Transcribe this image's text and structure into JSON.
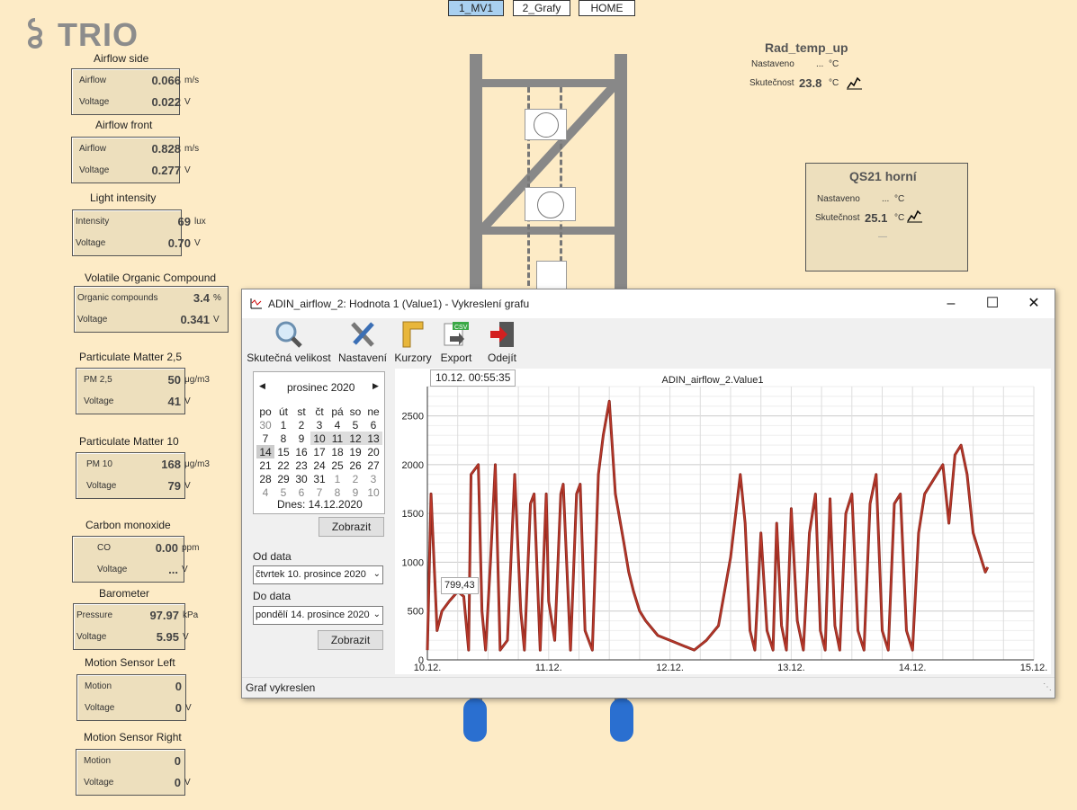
{
  "nav": {
    "tabs": [
      "1_MV1",
      "2_Grafy",
      "HOME"
    ]
  },
  "logo": {
    "text": "TRIO"
  },
  "sensors": {
    "airflow_side": {
      "title": "Airflow side",
      "r1_label": "Airflow",
      "r1_value": "0.066",
      "r1_unit": "m/s",
      "r2_label": "Voltage",
      "r2_value": "0.022",
      "r2_unit": "V"
    },
    "airflow_front": {
      "title": "Airflow front",
      "r1_label": "Airflow",
      "r1_value": "0.828",
      "r1_unit": "m/s",
      "r2_label": "Voltage",
      "r2_value": "0.277",
      "r2_unit": "V"
    },
    "light": {
      "title": "Light intensity",
      "r1_label": "Intensity",
      "r1_value": "69",
      "r1_unit": "lux",
      "r2_label": "Voltage",
      "r2_value": "0.70",
      "r2_unit": "V"
    },
    "voc": {
      "title": "Volatile Organic Compound",
      "r1_label": "Organic compounds",
      "r1_value": "3.4",
      "r1_unit": "%",
      "r2_label": "Voltage",
      "r2_value": "0.341",
      "r2_unit": "V"
    },
    "pm25": {
      "title": "Particulate Matter 2,5",
      "r1_label": "PM 2,5",
      "r1_value": "50",
      "r1_unit": "μg/m3",
      "r2_label": "Voltage",
      "r2_value": "41",
      "r2_unit": "V"
    },
    "pm10": {
      "title": "Particulate Matter 10",
      "r1_label": "PM 10",
      "r1_value": "168",
      "r1_unit": "μg/m3",
      "r2_label": "Voltage",
      "r2_value": "79",
      "r2_unit": "V"
    },
    "co": {
      "title": "Carbon monoxide",
      "r1_label": "CO",
      "r1_value": "0.00",
      "r1_unit": "ppm",
      "r2_label": "Voltage",
      "r2_value": "...",
      "r2_unit": "V"
    },
    "baro": {
      "title": "Barometer",
      "r1_label": "Pressure",
      "r1_value": "97.97",
      "r1_unit": "kPa",
      "r2_label": "Voltage",
      "r2_value": "5.95",
      "r2_unit": "V"
    },
    "motion_left": {
      "title": "Motion Sensor Left",
      "r1_label": "Motion",
      "r1_value": "0",
      "r1_unit": "",
      "r2_label": "Voltage",
      "r2_value": "0",
      "r2_unit": "V"
    },
    "motion_right": {
      "title": "Motion Sensor Right",
      "r1_label": "Motion",
      "r1_value": "0",
      "r1_unit": "",
      "r2_label": "Voltage",
      "r2_value": "0",
      "r2_unit": "V"
    }
  },
  "rad_temp": {
    "title": "Rad_temp_up",
    "set_label": "Nastaveno",
    "set_value": "...",
    "unit": "°C",
    "act_label": "Skutečnost",
    "act_value": "23.8"
  },
  "qs21": {
    "title": "QS21 horní",
    "set_label": "Nastaveno",
    "set_value": "...",
    "unit": "°C",
    "act_label": "Skutečnost",
    "act_value": "25.1",
    "extra": "—"
  },
  "window": {
    "title": "ADIN_airflow_2: Hodnota 1 (Value1) - Vykreslení grafu",
    "toolbar": [
      "Skutečná velikost",
      "Nastavení",
      "Kurzory",
      "Export",
      "Odejít"
    ],
    "export_badge": "CSV",
    "calendar": {
      "month": "prosinec 2020",
      "days": [
        "po",
        "út",
        "st",
        "čt",
        "pá",
        "so",
        "ne"
      ],
      "weeks": [
        [
          "30",
          "1",
          "2",
          "3",
          "4",
          "5",
          "6"
        ],
        [
          "7",
          "8",
          "9",
          "10",
          "11",
          "12",
          "13"
        ],
        [
          "14",
          "15",
          "16",
          "17",
          "18",
          "19",
          "20"
        ],
        [
          "21",
          "22",
          "23",
          "24",
          "25",
          "26",
          "27"
        ],
        [
          "28",
          "29",
          "30",
          "31",
          "1",
          "2",
          "3"
        ],
        [
          "4",
          "5",
          "6",
          "7",
          "8",
          "9",
          "10"
        ]
      ],
      "today_label": "Dnes: 14.12.2020"
    },
    "show_button": "Zobrazit",
    "from_label": "Od data",
    "from_value": "čtvrtek 10. prosince 2020",
    "to_label": "Do data",
    "to_value": "pondělí 14. prosince 2020",
    "show_button2": "Zobrazit",
    "status": "Graf vykreslen"
  },
  "chart_data": {
    "type": "line",
    "title": "ADIN_airflow_2.Value1",
    "cursor_time": "10.12. 00:55:35",
    "cursor_value": "799,43",
    "x_ticks": [
      "10.12.",
      "11.12.",
      "12.12.",
      "13.12.",
      "14.12.",
      "15.12."
    ],
    "y_ticks": [
      0,
      500,
      1000,
      1500,
      2000,
      2500
    ],
    "ylim": [
      0,
      2800
    ],
    "xlim_days": [
      10,
      15
    ],
    "series_color": "#c0392b",
    "series": [
      {
        "x": [
          10.0,
          10.03,
          10.08,
          10.12,
          10.18,
          10.25,
          10.3,
          10.34,
          10.36,
          10.42,
          10.45,
          10.48,
          10.52,
          10.56,
          10.6,
          10.66,
          10.72,
          10.77,
          10.8,
          10.85,
          10.88,
          10.93,
          10.98,
          11.0,
          11.05,
          11.1,
          11.12,
          11.18,
          11.23,
          11.26,
          11.3,
          11.36,
          11.41,
          11.45,
          11.5,
          11.55,
          11.62,
          11.66,
          11.7,
          11.75,
          11.8,
          11.9,
          12.0,
          12.1,
          12.2,
          12.3,
          12.4,
          12.5,
          12.58,
          12.62,
          12.66,
          12.7,
          12.75,
          12.8,
          12.85,
          12.88,
          12.92,
          12.96,
          13.0,
          13.05,
          13.1,
          13.15,
          13.2,
          13.24,
          13.28,
          13.32,
          13.36,
          13.4,
          13.45,
          13.5,
          13.55,
          13.6,
          13.65,
          13.7,
          13.75,
          13.8,
          13.85,
          13.9,
          13.95,
          14.0,
          14.05,
          14.1,
          14.15,
          14.2,
          14.25,
          14.3,
          14.35,
          14.4,
          14.45,
          14.5,
          14.55,
          14.6,
          14.62
        ],
        "y": [
          100,
          1700,
          300,
          500,
          600,
          700,
          650,
          100,
          1900,
          2000,
          500,
          100,
          1000,
          2000,
          100,
          200,
          1900,
          500,
          100,
          1600,
          1700,
          100,
          1700,
          600,
          200,
          1700,
          1800,
          100,
          1700,
          1800,
          300,
          100,
          1900,
          2300,
          2650,
          1700,
          1200,
          900,
          700,
          500,
          400,
          250,
          200,
          150,
          100,
          200,
          350,
          1050,
          1900,
          1400,
          300,
          100,
          1300,
          300,
          100,
          1400,
          350,
          100,
          1550,
          400,
          100,
          1300,
          1700,
          300,
          100,
          1650,
          350,
          100,
          1500,
          1700,
          300,
          100,
          1600,
          1900,
          300,
          100,
          1600,
          1700,
          300,
          100,
          1300,
          1700,
          1800,
          1900,
          2000,
          1400,
          2100,
          2200,
          1900,
          1300,
          1100,
          900,
          950
        ]
      }
    ]
  }
}
